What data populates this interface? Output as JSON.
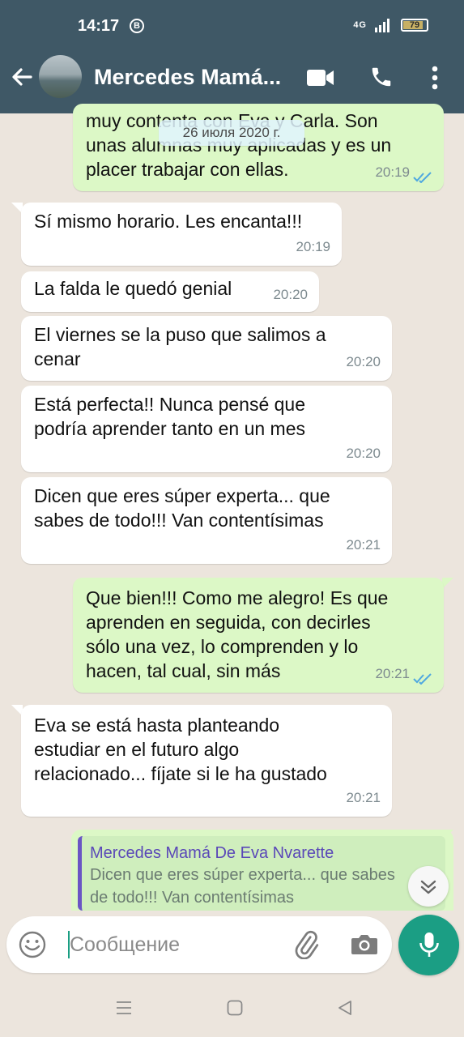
{
  "status_bar": {
    "time": "14:17",
    "b_icon": "B",
    "network": "4G",
    "battery": "79"
  },
  "header": {
    "contact_name": "Mercedes Mamá...",
    "icons": [
      "back-arrow-icon",
      "video-call-icon",
      "phone-icon",
      "more-vert-icon"
    ]
  },
  "date_chip": "26 июля 2020 г.",
  "messages": [
    {
      "dir": "out",
      "lines": [
        "muy contenta con Eva y Carla. Son",
        "unas alumnas muy aplicadas y es un",
        "placer trabajar con ellas."
      ],
      "time": "20:19",
      "ticks": true
    },
    {
      "dir": "in",
      "text": "Sí mismo horario. Les encanta!!!",
      "time": "20:19"
    },
    {
      "dir": "in",
      "text": "La falda le quedó genial",
      "time": "20:20"
    },
    {
      "dir": "in",
      "lines": [
        "El viernes se la puso que salimos a",
        "cenar"
      ],
      "time": "20:20"
    },
    {
      "dir": "in",
      "lines": [
        "Está perfecta!! Nunca pensé que",
        "podría aprender tanto en un mes"
      ],
      "time": "20:20"
    },
    {
      "dir": "in",
      "lines": [
        "Dicen que eres súper experta... que",
        "sabes de todo!!! Van contentísimas"
      ],
      "time": "20:21"
    },
    {
      "dir": "out",
      "lines": [
        "Que bien!!! Como me alegro! Es que",
        "aprenden en seguida, con decirles",
        "sólo una vez, lo comprenden y lo",
        "hacen, tal cual, sin más"
      ],
      "time": "20:21",
      "ticks": true
    },
    {
      "dir": "in",
      "lines": [
        "Eva se está hasta planteando",
        "estudiar en el futuro algo",
        "relacionado... fíjate si le ha gustado"
      ],
      "time": "20:21"
    }
  ],
  "reply": {
    "name": "Mercedes Mamá De Eva Nvarette",
    "lines": [
      "Dicen que eres súper experta... que sabes",
      "de todo!!! Van contentísimas"
    ]
  },
  "input": {
    "placeholder": "Сообщение"
  },
  "colors": {
    "header": "#3f5866",
    "chat_bg": "#ece5dd",
    "outgoing": "#dcf8c6",
    "incoming": "#ffffff",
    "accent": "#1b9e84",
    "ticks": "#4fa8e0"
  }
}
